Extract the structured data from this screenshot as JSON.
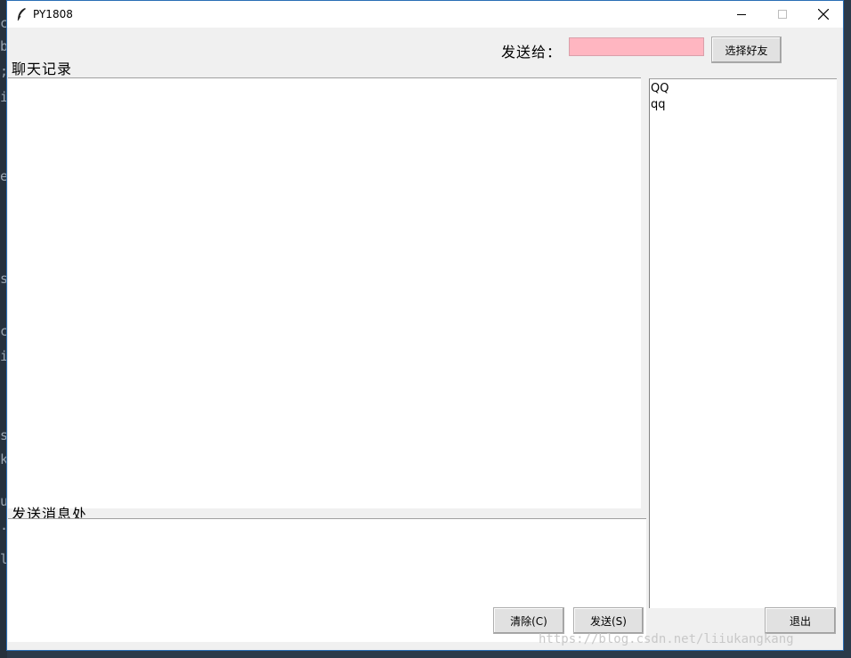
{
  "window": {
    "title": "PY1808"
  },
  "labels": {
    "chat_history": "聊天记录",
    "send_area": "发送消息处",
    "send_to": "发送给："
  },
  "send_to": {
    "value": "",
    "color": "#ffb6c1"
  },
  "buttons": {
    "select_friend": "选择好友",
    "clear": "清除(C)",
    "send": "发送(S)",
    "exit": "退出"
  },
  "friends": [
    "QQ",
    "qq"
  ],
  "watermark": "https://blog.csdn.net/liiukangkang",
  "background_code_chars": [
    "c",
    "b",
    ";",
    "i",
    "e",
    "s",
    "c",
    "i",
    "s",
    "k",
    "u",
    ".",
    "l"
  ]
}
